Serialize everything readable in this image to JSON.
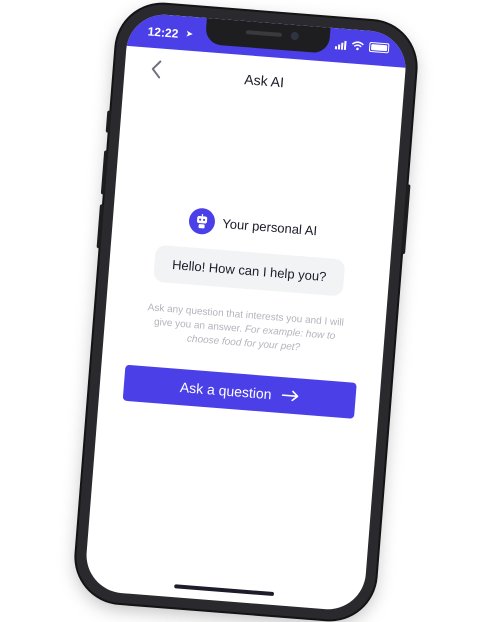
{
  "status_bar": {
    "time": "12:22",
    "location_glyph": "➤",
    "bg_color": "#4b3fe8"
  },
  "nav": {
    "title": "Ask AI",
    "back_icon": "chevron-left-icon"
  },
  "assistant": {
    "name": "Your personal AI",
    "avatar_icon": "robot-icon",
    "greeting": "Hello! How can I help you?",
    "hint_plain": "Ask any question that interests you and I will give you an answer.",
    "hint_example": "For example: how to choose food for your pet?"
  },
  "cta": {
    "label": "Ask a question",
    "icon": "arrow-right-icon",
    "color": "#4b3fe8"
  }
}
